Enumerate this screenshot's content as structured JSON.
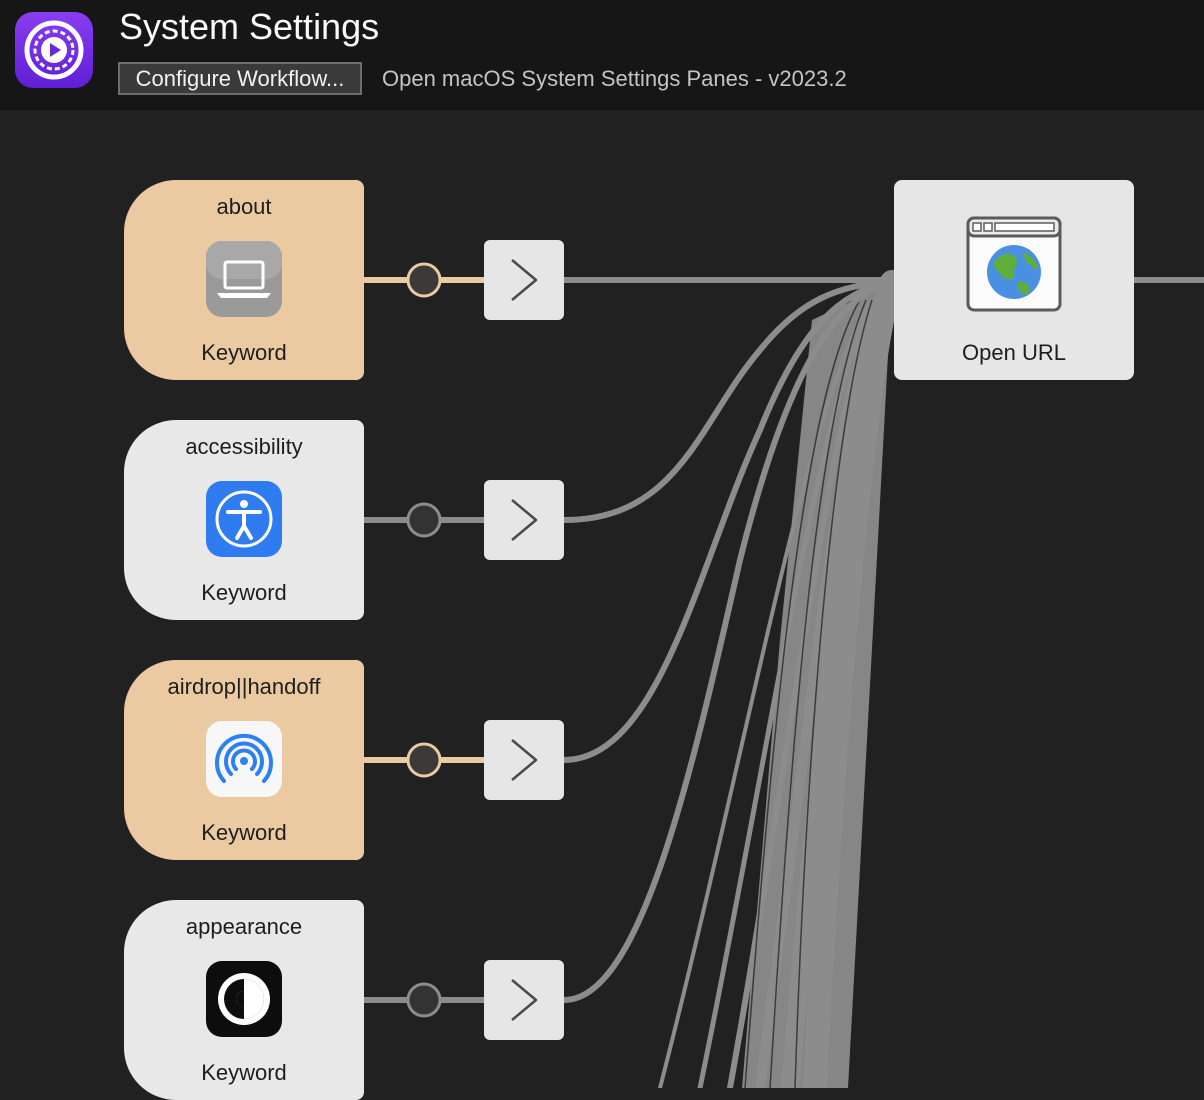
{
  "app": {
    "title": "System Settings",
    "icon": "gear-play-icon",
    "configure_label": "Configure Workflow...",
    "description": "Open macOS System Settings Panes - v2023.2"
  },
  "nodes": [
    {
      "label": "about",
      "type": "Keyword",
      "icon": "laptop-icon",
      "highlighted": true
    },
    {
      "label": "accessibility",
      "type": "Keyword",
      "icon": "accessibility-icon",
      "highlighted": false
    },
    {
      "label": "airdrop||handoff",
      "type": "Keyword",
      "icon": "airdrop-icon",
      "highlighted": true
    },
    {
      "label": "appearance",
      "type": "Keyword",
      "icon": "appearance-icon",
      "highlighted": false
    }
  ],
  "actions": [
    {
      "icon": "chevron-right-icon"
    },
    {
      "icon": "chevron-right-icon"
    },
    {
      "icon": "chevron-right-icon"
    },
    {
      "icon": "chevron-right-icon"
    }
  ],
  "output": {
    "label": "Open URL",
    "icon": "browser-globe-icon"
  },
  "colors": {
    "canvas": "#212121",
    "header": "#161616",
    "highlight": "#ebcaa2",
    "node": "#e8e8e8",
    "wire": "#8a8a8a",
    "accent": "#7a35e8"
  }
}
